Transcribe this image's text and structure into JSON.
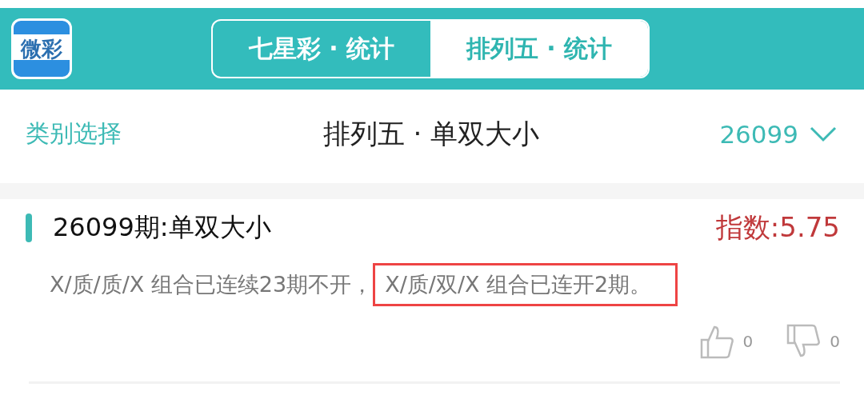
{
  "app_bar": {
    "logo": "微彩",
    "tabs": [
      {
        "label": "七星彩 · 统计",
        "selected": false
      },
      {
        "label": "排列五 · 统计",
        "selected": true
      }
    ]
  },
  "header": {
    "left_link": "类别选择",
    "title": "排列五 · 单双大小",
    "period": "26099"
  },
  "card": {
    "title": "26099期:单双大小",
    "index": "指数:5.75",
    "text": "X/质/质/X 组合已连续23期不开，",
    "highlighted_text": "X/质/双/X 组合已连开2期。",
    "likes": "0",
    "dislikes": "0"
  }
}
